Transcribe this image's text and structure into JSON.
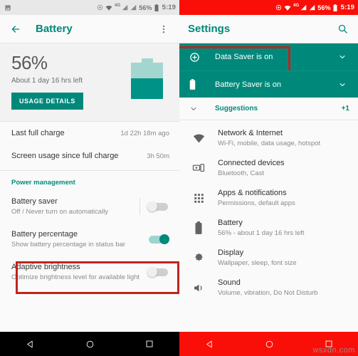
{
  "left_phone": {
    "status_bar": {
      "photo_icon": "image-icon",
      "icons": [
        "location-icon",
        "wifi-icon",
        "signal-icon",
        "signal-icon"
      ],
      "network_label": "4G",
      "battery_text": "56%",
      "battery_icon": "battery-icon",
      "time": "5:19"
    },
    "app_bar": {
      "back_icon": "back-arrow-icon",
      "title": "Battery",
      "overflow_icon": "more-vert-icon"
    },
    "summary": {
      "percent": "56%",
      "estimate": "About 1 day 16 hrs left",
      "usage_button": "USAGE DETAILS",
      "battery_graphic": {
        "fill_percent": 56
      }
    },
    "stats_rows": [
      {
        "label": "Last full charge",
        "value": "1d 22h 18m ago"
      },
      {
        "label": "Screen usage since full charge",
        "value": "3h 50m"
      }
    ],
    "section_title": "Power management",
    "settings_rows": [
      {
        "title": "Battery saver",
        "subtitle": "Off / Never turn on automatically",
        "toggle": "off",
        "highlighted": true
      },
      {
        "title": "Battery percentage",
        "subtitle": "Show battery percentage in status bar",
        "toggle": "on",
        "highlighted": false
      },
      {
        "title": "Adaptive brightness",
        "subtitle": "Optimize brightness level for available light",
        "toggle": "off",
        "highlighted": false
      }
    ],
    "nav_bar": {
      "back": "nav-back-icon",
      "home": "nav-home-icon",
      "recents": "nav-recents-icon"
    }
  },
  "right_phone": {
    "status_bar": {
      "icons": [
        "location-icon",
        "wifi-icon",
        "signal-icon",
        "signal-icon"
      ],
      "network_label": "4G",
      "battery_text": "56%",
      "battery_icon": "battery-icon",
      "time": "5:19"
    },
    "app_bar": {
      "title": "Settings",
      "search_icon": "search-icon"
    },
    "banners": [
      {
        "icon": "data-saver-icon",
        "label": "Data Saver is on",
        "chevron": "chevron-down-icon",
        "highlighted": true
      },
      {
        "icon": "battery-icon",
        "label": "Battery Saver is on",
        "chevron": "chevron-down-icon",
        "highlighted": false
      }
    ],
    "suggestions": {
      "chevron": "chevron-down-icon",
      "label": "Suggestions",
      "count": "+1"
    },
    "settings_items": [
      {
        "icon": "wifi-icon",
        "title": "Network & Internet",
        "subtitle": "Wi-Fi, mobile, data usage, hotspot"
      },
      {
        "icon": "cast-icon",
        "title": "Connected devices",
        "subtitle": "Bluetooth, Cast"
      },
      {
        "icon": "apps-grid-icon",
        "title": "Apps & notifications",
        "subtitle": "Permissions, default apps"
      },
      {
        "icon": "battery-icon",
        "title": "Battery",
        "subtitle": "56% - about 1 day 16 hrs left"
      },
      {
        "icon": "brightness-icon",
        "title": "Display",
        "subtitle": "Wallpaper, sleep, font size"
      },
      {
        "icon": "volume-icon",
        "title": "Sound",
        "subtitle": "Volume, vibration, Do Not Disturb"
      }
    ],
    "nav_bar": {
      "back": "nav-back-icon",
      "home": "nav-home-icon",
      "recents": "nav-recents-icon"
    },
    "watermark": "wsxdn.com"
  },
  "colors": {
    "teal": "#00897b",
    "red_status": "#fa0f08",
    "highlight": "#c0231f"
  }
}
